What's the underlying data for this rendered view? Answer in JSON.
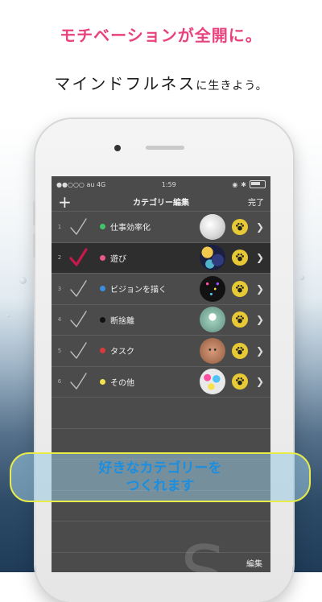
{
  "promo": {
    "headline": "モチベーションが全開に。",
    "headline_color": "#e8437e",
    "sub_main": "マインドフルネス",
    "sub_small": "に生きよう。",
    "callout_line1": "好きなカテゴリーを",
    "callout_line2": "つくれます"
  },
  "status_bar": {
    "carrier": "●●○○○ au  4G",
    "time": "1:59"
  },
  "navbar": {
    "add_icon": "+",
    "title": "カテゴリー編集",
    "done_label": "完了"
  },
  "categories": [
    {
      "num": "1",
      "label": "仕事効率化",
      "color": "#43c46b",
      "checked_color": "#bdbdbd",
      "selected": false,
      "thumb": "paper"
    },
    {
      "num": "2",
      "label": "遊び",
      "color": "#e85a8c",
      "checked_color": "#c8194d",
      "selected": true,
      "thumb": "pattern"
    },
    {
      "num": "3",
      "label": "ビジョンを描く",
      "color": "#3a8ee0",
      "checked_color": "#bdbdbd",
      "selected": false,
      "thumb": "confetti"
    },
    {
      "num": "4",
      "label": "断捨離",
      "color": "#111111",
      "checked_color": "#bdbdbd",
      "selected": false,
      "thumb": "leaf"
    },
    {
      "num": "5",
      "label": "タスク",
      "color": "#d93a3a",
      "checked_color": "#bdbdbd",
      "selected": false,
      "thumb": "face"
    },
    {
      "num": "6",
      "label": "その他",
      "color": "#f5e451",
      "checked_color": "#bdbdbd",
      "selected": false,
      "thumb": "colors"
    }
  ],
  "bottom_bar": {
    "edit_label": "編集"
  },
  "watermark": "S"
}
